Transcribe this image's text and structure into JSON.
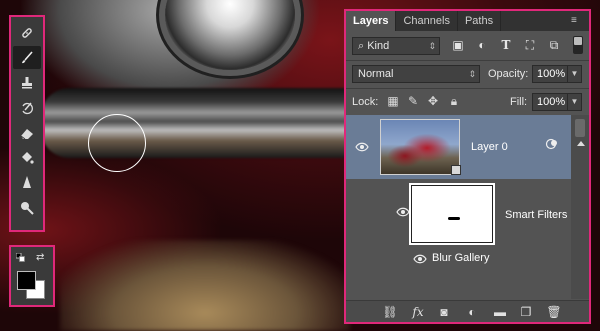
{
  "tabs": [
    {
      "label": "Layers",
      "active": true
    },
    {
      "label": "Channels",
      "active": false
    },
    {
      "label": "Paths",
      "active": false
    }
  ],
  "filter": {
    "kind_label": "Kind",
    "icons": [
      "image-filter-icon",
      "adjustment-filter-icon",
      "type-filter-icon",
      "shape-filter-icon",
      "smart-object-filter-icon"
    ]
  },
  "blend": {
    "mode": "Normal",
    "opacity_label": "Opacity:",
    "opacity_value": "100%"
  },
  "lock": {
    "label": "Lock:",
    "fill_label": "Fill:",
    "fill_value": "100%"
  },
  "layers": {
    "layer_name": "Layer 0",
    "smart_filters_label": "Smart Filters",
    "filter_name": "Blur Gallery"
  },
  "tools": [
    "healing-brush-icon",
    "brush-icon",
    "clone-stamp-icon",
    "history-brush-icon",
    "eraser-icon",
    "paint-bucket-icon",
    "sharpen-icon",
    "dodge-icon"
  ],
  "bottom_icons": [
    "link-icon",
    "fx-icon",
    "mask-icon",
    "adjustment-icon",
    "group-icon",
    "new-layer-icon",
    "trash-icon"
  ],
  "colors": {
    "foreground": "#000000",
    "background": "#ffffff",
    "accent_outline": "#e0287a",
    "selected_layer": "#6a7c96"
  }
}
